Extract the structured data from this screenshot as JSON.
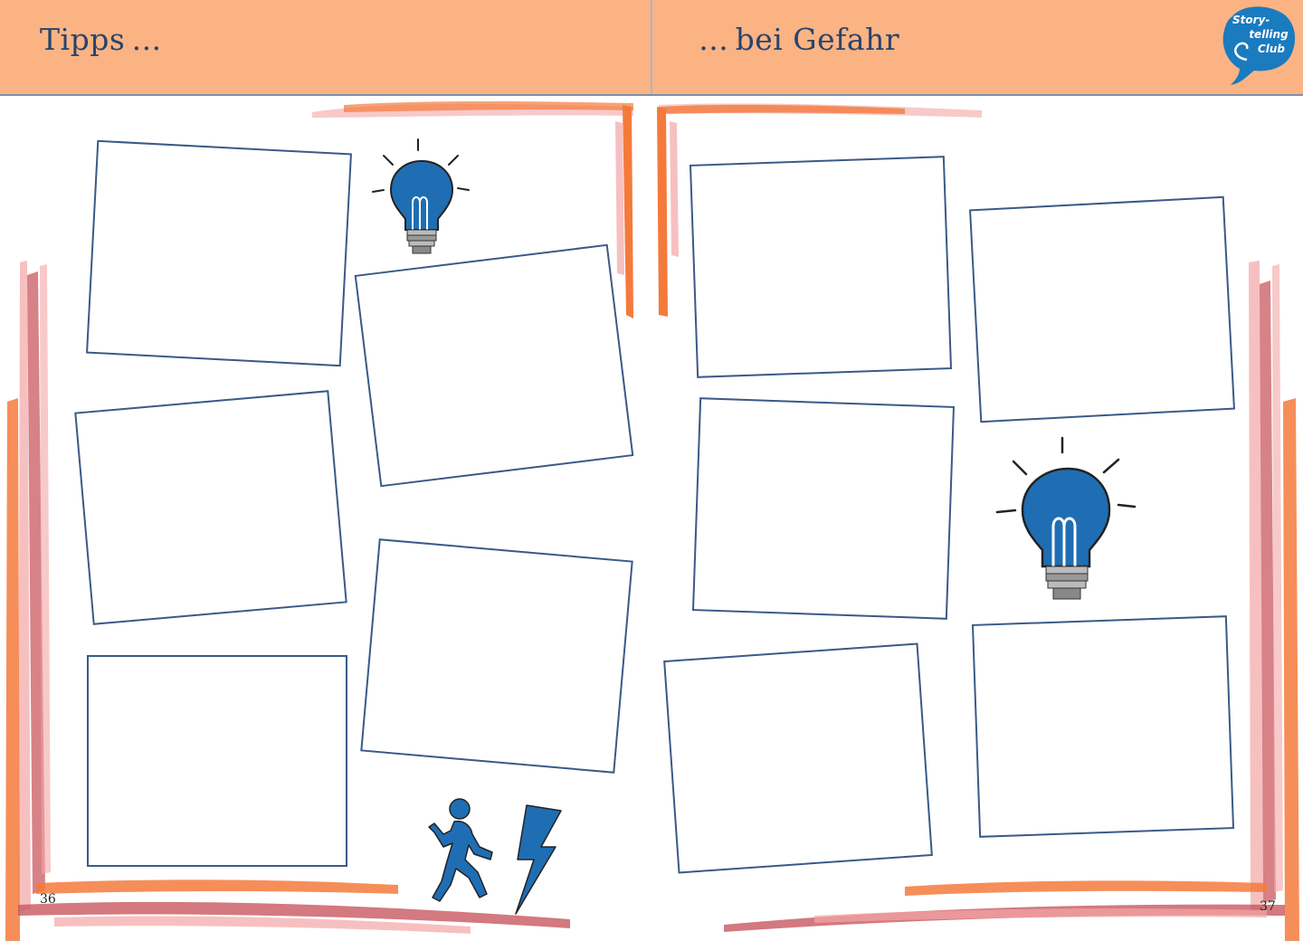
{
  "header": {
    "left_title": "Tipps …",
    "right_title": "… bei Gefahr"
  },
  "logo": {
    "line1": "Story-",
    "line2": "telling",
    "line3": "Club",
    "color": "#1a7bbf"
  },
  "pages": {
    "left_number": "36",
    "right_number": "37"
  },
  "colors": {
    "header_bg": "#fbb383",
    "title_text": "#27446e",
    "frame_border": "#3a5a86",
    "icon_blue": "#1f6eb3",
    "brush_orange": "#f47a3c",
    "brush_red": "#c8585f",
    "brush_pink": "#f3a5a5"
  },
  "icons": [
    "lightbulb-icon",
    "lightbulb-icon",
    "running-person-icon",
    "lightning-icon"
  ]
}
